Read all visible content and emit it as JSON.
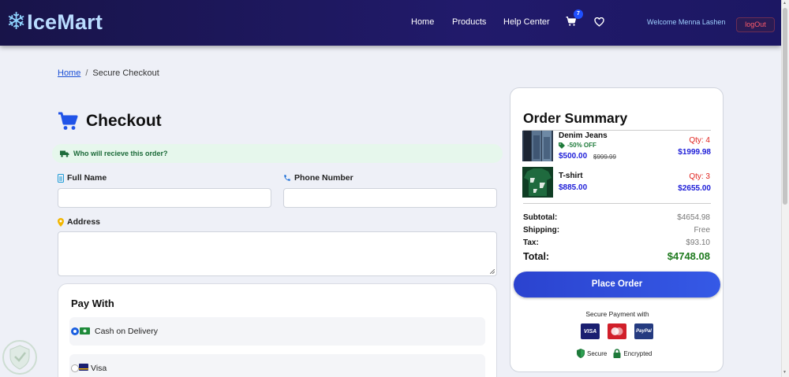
{
  "brand": {
    "name": "IceMart",
    "logo_icon": "snowflake-icon"
  },
  "nav": {
    "links": [
      "Home",
      "Products",
      "Help Center"
    ],
    "cart_count": "7",
    "welcome": "Welcome Menna Lashen",
    "logout": "logOut"
  },
  "breadcrumb": {
    "home": "Home",
    "separator": "/",
    "current": "Secure Checkout"
  },
  "checkout": {
    "title": "Checkout",
    "who_prompt": "Who will recieve this order?",
    "full_name_label": "Full Name",
    "phone_label": "Phone Number",
    "address_label": "Address",
    "full_name_value": "",
    "phone_value": "",
    "address_value": ""
  },
  "payment": {
    "title": "Pay With",
    "options": [
      {
        "label": "Cash on Delivery",
        "selected": true
      },
      {
        "label": "Visa",
        "selected": false
      }
    ]
  },
  "summary": {
    "title": "Order Summary",
    "items": [
      {
        "name": "Denim Jeans",
        "discount": "-50% OFF",
        "price": "$500.00",
        "old_price": "$999.99",
        "qty": "Qty: 4",
        "line_total": "$1999.98"
      },
      {
        "name": "T-shirt",
        "price": "$885.00",
        "qty": "Qty: 3",
        "line_total": "$2655.00"
      }
    ],
    "subtotal_label": "Subtotal:",
    "subtotal": "$4654.98",
    "shipping_label": "Shipping:",
    "shipping": "Free",
    "tax_label": "Tax:",
    "tax": "$93.10",
    "total_label": "Total:",
    "total": "$4748.08",
    "place_order": "Place Order",
    "secure_payment": "Secure Payment with",
    "cards": [
      "VISA",
      "Mastercard",
      "PayPal"
    ],
    "secure": "Secure",
    "encrypted": "Encrypted"
  },
  "colors": {
    "nav_bg": "#1c1763",
    "accent": "#2b43cf",
    "price": "#2020d8",
    "total": "#1e7a1e",
    "qty": "#e0241f"
  }
}
